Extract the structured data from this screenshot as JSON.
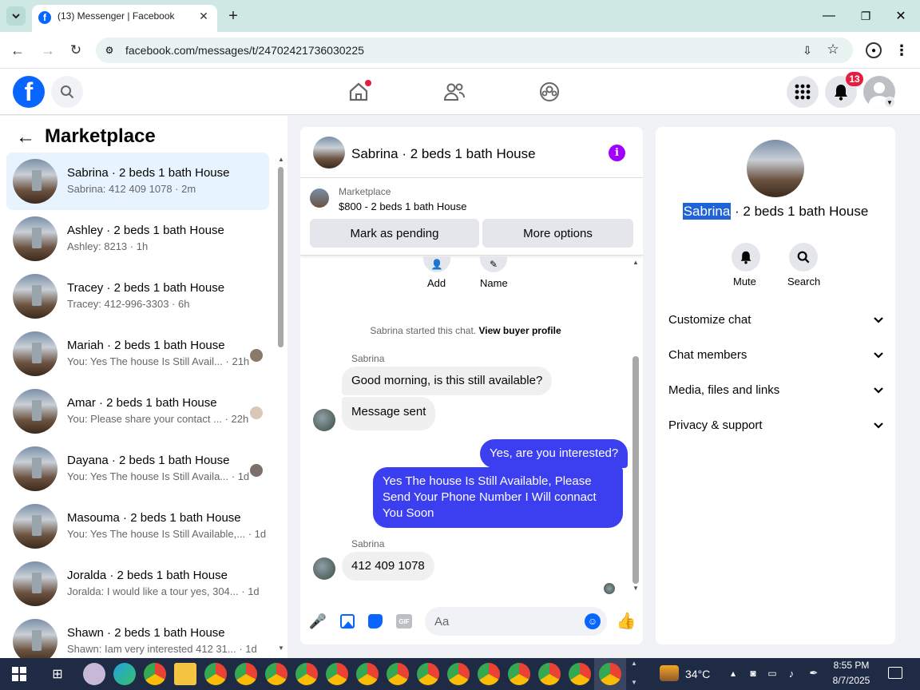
{
  "browser": {
    "tab_title": "(13) Messenger | Facebook",
    "url": "facebook.com/messages/t/24702421736030225"
  },
  "fb": {
    "notification_count": "13"
  },
  "sidebar": {
    "title": "Marketplace",
    "conversations": [
      {
        "name": "Sabrina · 2 beds 1 bath House",
        "preview": "Sabrina: 412 409 1078 · 2m",
        "active": true
      },
      {
        "name": "Ashley · 2 beds 1 bath House",
        "preview": "Ashley: 8213 · 1h"
      },
      {
        "name": "Tracey · 2 beds 1 bath House",
        "preview": "Tracey: 412-996-3303 · 6h"
      },
      {
        "name": "Mariah · 2 beds 1 bath House",
        "preview": "You: Yes The house Is Still Avail...",
        "time": "· 21h"
      },
      {
        "name": "Amar · 2 beds 1 bath House",
        "preview": "You: Please share your contact ...",
        "time": "· 22h"
      },
      {
        "name": "Dayana · 2 beds 1 bath House",
        "preview": "You: Yes The house Is Still Availa...",
        "time": "· 1d"
      },
      {
        "name": "Masouma · 2 beds 1 bath House",
        "preview": "You: Yes The house Is Still Available,...",
        "time": "· 1d"
      },
      {
        "name": "Joralda · 2 beds 1 bath House",
        "preview": "Joralda: I would like a tour yes, 304...",
        "time": "· 1d"
      },
      {
        "name": "Shawn · 2 beds 1 bath House",
        "preview": "Shawn: Iam very interested 412 31...",
        "time": "· 1d"
      }
    ]
  },
  "chat": {
    "header_title": "Sabrina · 2 beds 1 bath House",
    "listing_source": "Marketplace",
    "listing_title": "$800 - 2 beds 1 bath House",
    "mark_pending_label": "Mark as pending",
    "more_options_label": "More options",
    "add_label": "Add",
    "name_label": "Name",
    "started_text": "Sabrina started this chat.",
    "view_profile_label": "View buyer profile",
    "sender_1": "Sabrina",
    "msg_1": "Good morning, is this still available?",
    "msg_2": "Message sent",
    "msg_3": "Yes, are you interested?",
    "msg_4": "Yes The house Is Still Available, Please Send Your Phone Number I Will connact You Soon",
    "sender_2": "Sabrina",
    "msg_5": "412 409 1078",
    "input_placeholder": "Aa"
  },
  "right_panel": {
    "name_highlight": "Sabrina",
    "name_rest": " · 2 beds 1 bath House",
    "mute_label": "Mute",
    "search_label": "Search",
    "sections": [
      "Customize chat",
      "Chat members",
      "Media, files and links",
      "Privacy & support"
    ]
  },
  "taskbar": {
    "weather": "34°C",
    "time": "8:55 PM",
    "date": "8/7/2025"
  },
  "colors": {
    "accent": "#0866ff",
    "outgoing_bubble": "#3b3ff0",
    "info_icon": "#a100ff",
    "notification": "#e41e3f"
  }
}
